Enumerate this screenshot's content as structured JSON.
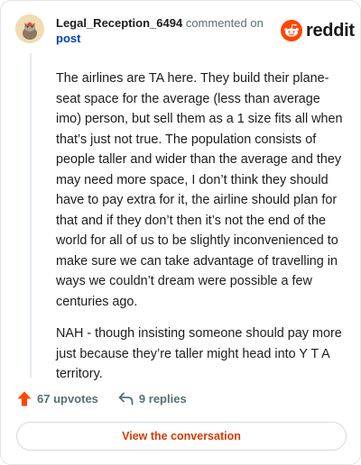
{
  "header": {
    "username": "Legal_Reception_6494",
    "action": "commented on",
    "target": "post",
    "logo_text": "reddit"
  },
  "comment": {
    "paragraphs": [
      "The airlines are TA here. They build their plane-seat space for the average (less than average imo) person, but sell them as a 1 size fits all when that’s just not true. The population consists of people taller and wider than the average and they may need more space, I don’t think they should have to pay extra for it, the airline should plan for that and if they don’t then it’s not the end of the world for all of us to be slightly inconvenienced to make sure we can take advantage of travelling in ways we couldn’t dream were possible a few centuries ago.",
      "NAH - though insisting someone should pay more just because they’re taller might head into Y T A territory."
    ]
  },
  "footer": {
    "upvotes": "67 upvotes",
    "replies": "9 replies",
    "view_button": "View the conversation"
  },
  "icons": {
    "avatar": "avatar-icon",
    "logo": "reddit-snoo-icon",
    "upvote": "upvote-arrow-icon",
    "reply": "reply-arrow-icon"
  },
  "colors": {
    "brand_orange": "#ff4500",
    "upvote": "#ff4500",
    "button_text": "#d93a00",
    "link": "#0045ac",
    "muted": "#576f76"
  }
}
